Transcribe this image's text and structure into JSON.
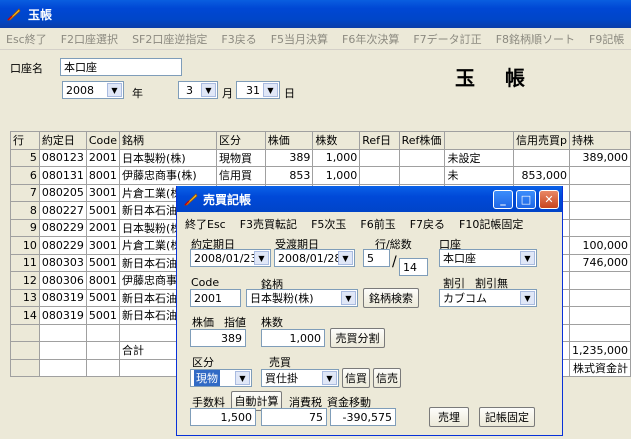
{
  "window": {
    "title": "玉帳"
  },
  "menu": [
    "Esc終了",
    "F2口座選択",
    "SF2口座逆指定",
    "F3戻る",
    "F5当月決算",
    "F6年次決算",
    "F7データ訂正",
    "F8銘柄順ソート",
    "F9記帳"
  ],
  "header": {
    "account_label": "口座名",
    "account_value": "本口座",
    "year": "2008",
    "year_unit": "年",
    "month": "3",
    "month_unit": "月",
    "day": "31",
    "day_unit": "日",
    "ledger_title": "玉帳"
  },
  "grid": {
    "columns": [
      "行",
      "約定日",
      "Code",
      "銘柄",
      "区分",
      "株価",
      "株数",
      "Ref日",
      "Ref株価",
      "",
      "信用売買p",
      "持株"
    ],
    "rows": [
      {
        "n": "5",
        "date": "080123",
        "code": "2001",
        "name": "日本製粉(株)",
        "kind": "現物買",
        "price": "389",
        "qty": "1,000",
        "c9": "未設定",
        "credit": "",
        "hold": "389,000"
      },
      {
        "n": "6",
        "date": "080131",
        "code": "8001",
        "name": "伊藤忠商事(株)",
        "kind": "信用買",
        "price": "853",
        "qty": "1,000",
        "c9": "未",
        "credit": "853,000",
        "hold": ""
      },
      {
        "n": "7",
        "date": "080205",
        "code": "3001",
        "name": "片倉工業(株)",
        "kind": "",
        "price": "",
        "qty": "",
        "c9": "",
        "credit": "",
        "hold": ""
      },
      {
        "n": "8",
        "date": "080227",
        "code": "5001",
        "name": "新日本石油(株)",
        "kind": "",
        "price": "",
        "qty": "",
        "c9": "",
        "credit": "",
        "hold": ""
      },
      {
        "n": "9",
        "date": "080229",
        "code": "2001",
        "name": "日本製粉(株)",
        "kind": "",
        "price": "",
        "qty": "",
        "c9": "",
        "credit": "",
        "hold": ""
      },
      {
        "n": "10",
        "date": "080229",
        "code": "3001",
        "name": "片倉工業(株)",
        "kind": "",
        "price": "",
        "qty": "",
        "c9": "",
        "credit": "",
        "hold": "100,000"
      },
      {
        "n": "11",
        "date": "080303",
        "code": "5001",
        "name": "新日本石油(株)",
        "kind": "",
        "price": "",
        "qty": "",
        "c9": "",
        "credit": "",
        "hold": "746,000"
      },
      {
        "n": "12",
        "date": "080306",
        "code": "8001",
        "name": "伊藤忠商事(株)",
        "kind": "",
        "price": "",
        "qty": "",
        "c9": "",
        "credit": "",
        "hold": ""
      },
      {
        "n": "13",
        "date": "080319",
        "code": "5001",
        "name": "新日本石油(株)",
        "kind": "",
        "price": "",
        "qty": "",
        "c9": "",
        "credit": "",
        "hold": ""
      },
      {
        "n": "14",
        "date": "080319",
        "code": "5001",
        "name": "新日本石油(株)",
        "kind": "",
        "price": "",
        "qty": "",
        "c9": "",
        "credit": "",
        "hold": ""
      },
      {
        "n": "",
        "date": "",
        "code": "",
        "name": "",
        "kind": "",
        "price": "",
        "qty": "",
        "c9": "",
        "credit": "",
        "hold": ""
      },
      {
        "n": "",
        "date": "",
        "code": "",
        "name": "合計",
        "kind": "",
        "price": "",
        "qty": "",
        "c9": "",
        "credit": "",
        "hold": "1,235,000"
      },
      {
        "n": "",
        "date": "",
        "code": "",
        "name": "",
        "kind": "",
        "price": "",
        "qty": "",
        "c9": "",
        "credit": "",
        "hold": "株式資金計"
      }
    ]
  },
  "dialog": {
    "title": "売買記帳",
    "menu": [
      "終了Esc",
      "F3売買転記",
      "F5次玉",
      "F6前玉",
      "F7戻る",
      "F10記帳固定"
    ],
    "trade_date_label": "約定期日",
    "trade_date": "2008/01/23",
    "settle_date_label": "受渡期日",
    "settle_date": "2008/01/28",
    "row_total_label": "行/総数",
    "row": "5",
    "total": "14",
    "account_label": "口座",
    "account": "本口座",
    "discount_label": "割引",
    "no_discount_label": "割引無",
    "broker": "カブコム",
    "code_label": "Code",
    "code": "2001",
    "brand_label": "銘柄",
    "brand": "日本製粉(株)",
    "brand_search": "銘柄検索",
    "price_label": "株価",
    "limit_label": "指値",
    "qty_label": "株数",
    "price": "389",
    "qty": "1,000",
    "split_button": "売買分割",
    "kind_label": "区分",
    "kind": "現物",
    "trade_label": "売買",
    "trade": "買仕掛",
    "credit_buy": "信買",
    "credit_sell": "信売",
    "fee_label": "手数料",
    "auto_calc": "自動計算",
    "tax_label": "消費税",
    "fund_label": "資金移動",
    "fee": "1,500",
    "tax": "75",
    "fund": "-390,575",
    "sell_button": "売埋",
    "fix_button": "記帳固定"
  }
}
